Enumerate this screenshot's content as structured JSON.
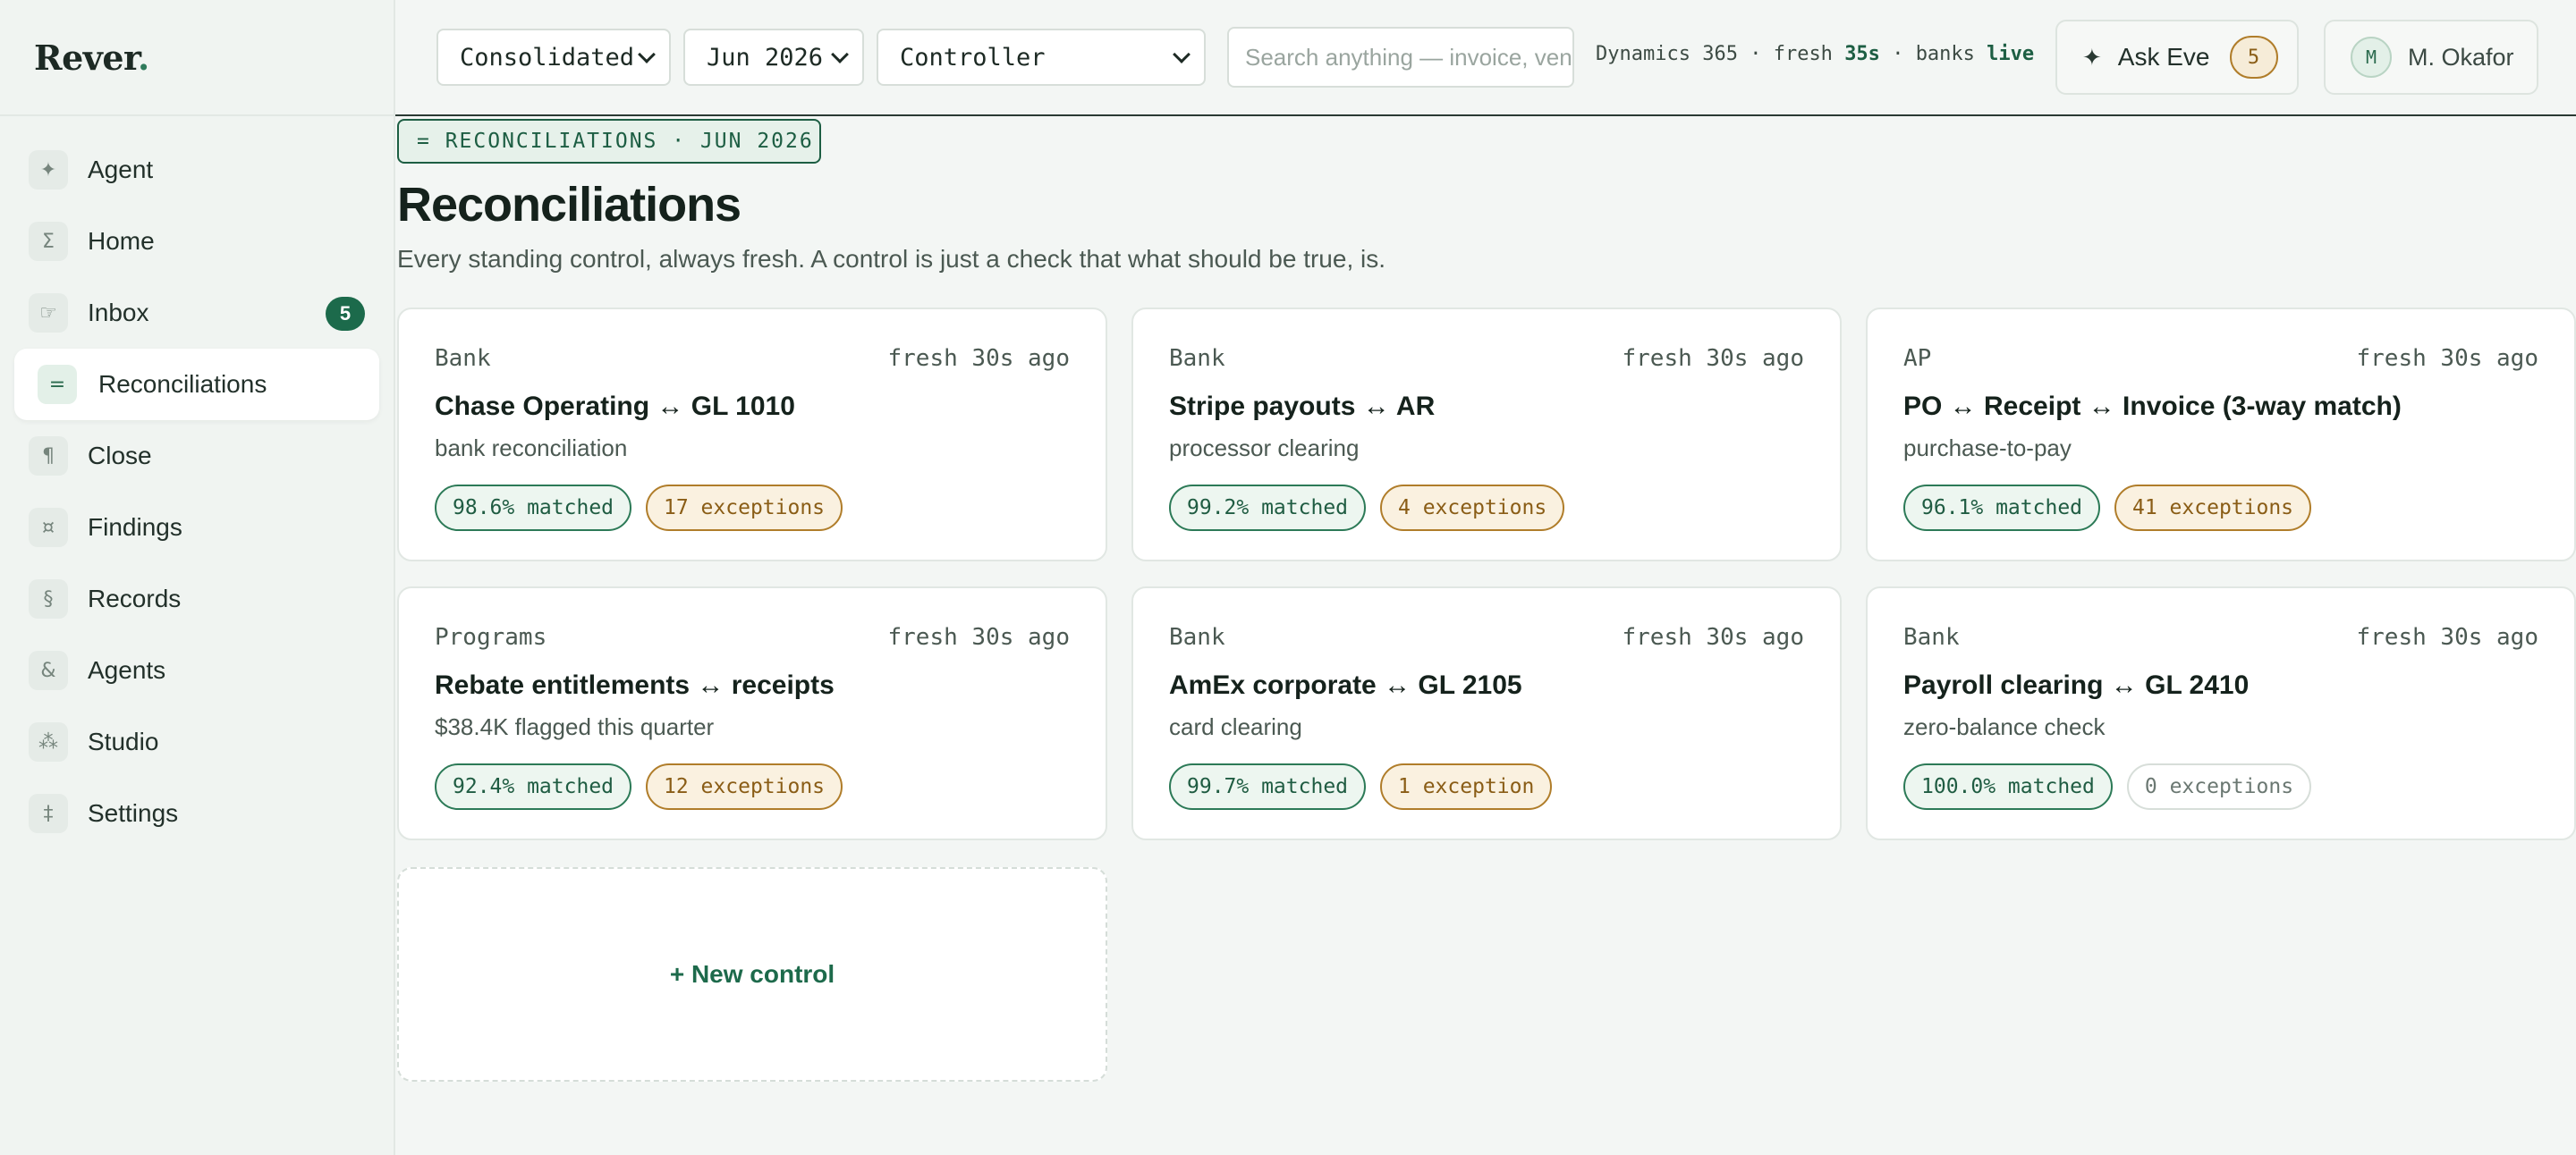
{
  "brand": {
    "name": "Rever",
    "dot": "."
  },
  "sidebar": {
    "items": [
      {
        "label": "Agent",
        "icon": "✦",
        "icon_name": "sparkle-icon"
      },
      {
        "label": "Home",
        "icon": "Σ",
        "icon_name": "sigma-icon"
      },
      {
        "label": "Inbox",
        "icon": "☞",
        "icon_name": "inbox-icon",
        "badge": "5"
      },
      {
        "label": "Reconciliations",
        "icon": "=",
        "icon_name": "equals-icon",
        "active": true
      },
      {
        "label": "Close",
        "icon": "¶",
        "icon_name": "pilcrow-icon"
      },
      {
        "label": "Findings",
        "icon": "¤",
        "icon_name": "findings-icon"
      },
      {
        "label": "Records",
        "icon": "§",
        "icon_name": "section-icon"
      },
      {
        "label": "Agents",
        "icon": "&",
        "icon_name": "ampersand-icon"
      },
      {
        "label": "Studio",
        "icon": "⁂",
        "icon_name": "asterism-icon"
      },
      {
        "label": "Settings",
        "icon": "‡",
        "icon_name": "double-dagger-icon"
      }
    ]
  },
  "topbar": {
    "entity": "Consolidated",
    "period": "Jun 2026",
    "role": "Controller",
    "search_placeholder": "Search anything — invoice, vendor",
    "status": {
      "source": "Dynamics 365",
      "sep1": "·",
      "fresh_label": "fresh",
      "fresh_value": "35s",
      "sep2": "·",
      "banks_label": "banks",
      "banks_value": "live"
    },
    "ask_label": "Ask Eve",
    "ask_icon": "✦",
    "ask_count": "5",
    "user_initial": "M",
    "user_name": "M. Okafor"
  },
  "main": {
    "breadcrumb": "= RECONCILIATIONS · JUN 2026",
    "title": "Reconciliations",
    "subtitle": "Every standing control, always fresh. A control is just a check that what should be true, is.",
    "new_control": "+ New control",
    "cards": [
      {
        "category": "Bank",
        "fresh": "fresh 30s ago",
        "title": "Chase Operating ↔ GL 1010",
        "subtitle": "bank reconciliation",
        "matched": "98.6% matched",
        "exceptions": "17 exceptions",
        "exc_state": "warn"
      },
      {
        "category": "Bank",
        "fresh": "fresh 30s ago",
        "title": "Stripe payouts ↔ AR",
        "subtitle": "processor clearing",
        "matched": "99.2% matched",
        "exceptions": "4 exceptions",
        "exc_state": "warn"
      },
      {
        "category": "AP",
        "fresh": "fresh 30s ago",
        "title": "PO ↔ Receipt ↔ Invoice (3-way match)",
        "subtitle": "purchase-to-pay",
        "matched": "96.1% matched",
        "exceptions": "41 exceptions",
        "exc_state": "warn"
      },
      {
        "category": "Programs",
        "fresh": "fresh 30s ago",
        "title": "Rebate entitlements ↔ receipts",
        "subtitle": "$38.4K flagged this quarter",
        "matched": "92.4% matched",
        "exceptions": "12 exceptions",
        "exc_state": "warn"
      },
      {
        "category": "Bank",
        "fresh": "fresh 30s ago",
        "title": "AmEx corporate ↔ GL 2105",
        "subtitle": "card clearing",
        "matched": "99.7% matched",
        "exceptions": "1 exception",
        "exc_state": "warn"
      },
      {
        "category": "Bank",
        "fresh": "fresh 30s ago",
        "title": "Payroll clearing ↔ GL 2410",
        "subtitle": "zero-balance check",
        "matched": "100.0% matched",
        "exceptions": "0 exceptions",
        "exc_state": "none"
      }
    ]
  }
}
